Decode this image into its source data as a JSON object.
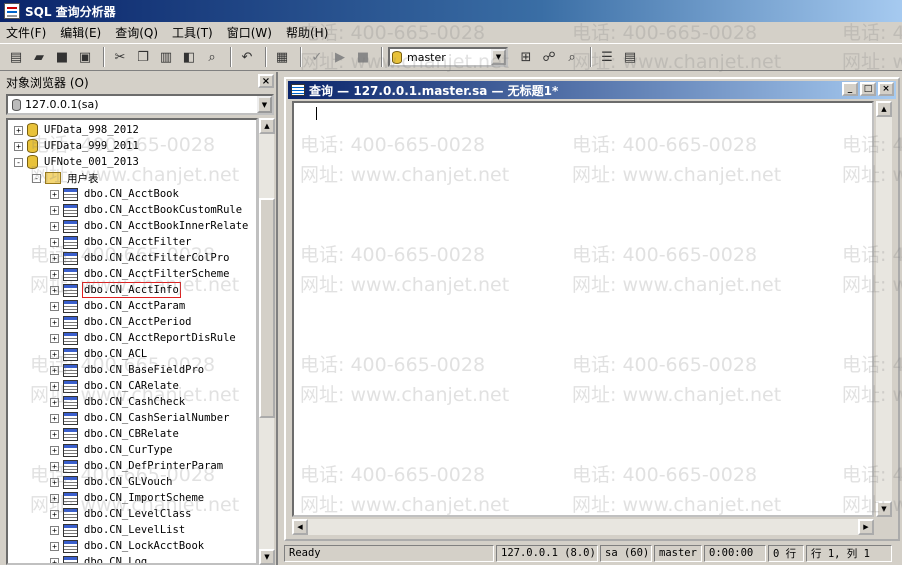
{
  "window": {
    "title": "SQL 查询分析器"
  },
  "menu": [
    "文件(F)",
    "编辑(E)",
    "查询(Q)",
    "工具(T)",
    "窗口(W)",
    "帮助(H)"
  ],
  "toolbar": {
    "database": "master"
  },
  "object_browser": {
    "title": "对象浏览器 (O)",
    "close_label": "×",
    "server": "127.0.0.1(sa)",
    "tree": [
      {
        "label": "UFData_998_2012",
        "type": "db",
        "expander": "+",
        "level": 0
      },
      {
        "label": "UFData_999_2011",
        "type": "db",
        "expander": "+",
        "level": 0
      },
      {
        "label": "UFNote_001_2013",
        "type": "db",
        "expander": "-",
        "level": 0
      },
      {
        "label": "用户表",
        "type": "folder",
        "expander": "-",
        "level": 1
      },
      {
        "label": "dbo.CN_AcctBook",
        "type": "table",
        "expander": "+",
        "level": 2
      },
      {
        "label": "dbo.CN_AcctBookCustomRule",
        "type": "table",
        "expander": "+",
        "level": 2
      },
      {
        "label": "dbo.CN_AcctBookInnerRelate",
        "type": "table",
        "expander": "+",
        "level": 2
      },
      {
        "label": "dbo.CN_AcctFilter",
        "type": "table",
        "expander": "+",
        "level": 2
      },
      {
        "label": "dbo.CN_AcctFilterColPro",
        "type": "table",
        "expander": "+",
        "level": 2
      },
      {
        "label": "dbo.CN_AcctFilterScheme",
        "type": "table",
        "expander": "+",
        "level": 2
      },
      {
        "label": "dbo.CN_AcctInfo",
        "type": "table",
        "expander": "+",
        "level": 2,
        "highlighted": true
      },
      {
        "label": "dbo.CN_AcctParam",
        "type": "table",
        "expander": "+",
        "level": 2
      },
      {
        "label": "dbo.CN_AcctPeriod",
        "type": "table",
        "expander": "+",
        "level": 2
      },
      {
        "label": "dbo.CN_AcctReportDisRule",
        "type": "table",
        "expander": "+",
        "level": 2
      },
      {
        "label": "dbo.CN_ACL",
        "type": "table",
        "expander": "+",
        "level": 2
      },
      {
        "label": "dbo.CN_BaseFieldPro",
        "type": "table",
        "expander": "+",
        "level": 2
      },
      {
        "label": "dbo.CN_CARelate",
        "type": "table",
        "expander": "+",
        "level": 2
      },
      {
        "label": "dbo.CN_CashCheck",
        "type": "table",
        "expander": "+",
        "level": 2
      },
      {
        "label": "dbo.CN_CashSerialNumber",
        "type": "table",
        "expander": "+",
        "level": 2
      },
      {
        "label": "dbo.CN_CBRelate",
        "type": "table",
        "expander": "+",
        "level": 2
      },
      {
        "label": "dbo.CN_CurType",
        "type": "table",
        "expander": "+",
        "level": 2
      },
      {
        "label": "dbo.CN_DefPrinterParam",
        "type": "table",
        "expander": "+",
        "level": 2
      },
      {
        "label": "dbo.CN_GLVouch",
        "type": "table",
        "expander": "+",
        "level": 2
      },
      {
        "label": "dbo.CN_ImportScheme",
        "type": "table",
        "expander": "+",
        "level": 2
      },
      {
        "label": "dbo.CN_LevelClass",
        "type": "table",
        "expander": "+",
        "level": 2
      },
      {
        "label": "dbo.CN_LevelList",
        "type": "table",
        "expander": "+",
        "level": 2
      },
      {
        "label": "dbo.CN_LockAcctBook",
        "type": "table",
        "expander": "+",
        "level": 2
      },
      {
        "label": "dbo.CN_Log",
        "type": "table",
        "expander": "+",
        "level": 2
      }
    ]
  },
  "query_window": {
    "title": "查询 — 127.0.0.1.master.sa — 无标题1*"
  },
  "watermark": {
    "phone": "电话: 400-665-0028",
    "site": "网址: www.chanjet.net"
  },
  "status": {
    "state": "Ready",
    "server": "127.0.0.1 (8.0)",
    "user": "sa (60)",
    "database": "master",
    "elapsed": "0:00:00",
    "rows": "0 行",
    "position": "行 1, 列 1"
  }
}
